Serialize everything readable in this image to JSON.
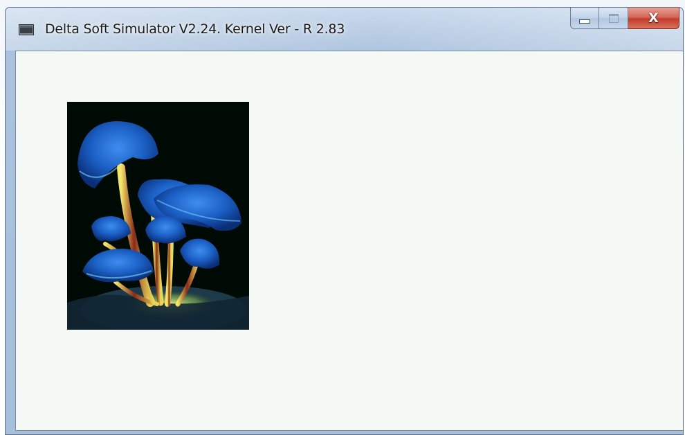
{
  "window": {
    "title": "Delta Soft Simulator V2.24. Kernel Ver - R 2.83",
    "icon": "app-window-icon",
    "caption_buttons": {
      "minimize_icon": "minimize-icon",
      "maximize_icon": "maximize-icon",
      "close_icon": "close-icon",
      "close_glyph": "X"
    }
  },
  "client": {
    "background": "#f5f9f6",
    "image": {
      "subject": "glowing-mushrooms-image",
      "background": "#000a04"
    }
  },
  "colors": {
    "close_button": "#c13c2a",
    "mushroom_cap": "#1f6fd6",
    "mushroom_stem": "#e6e070"
  }
}
